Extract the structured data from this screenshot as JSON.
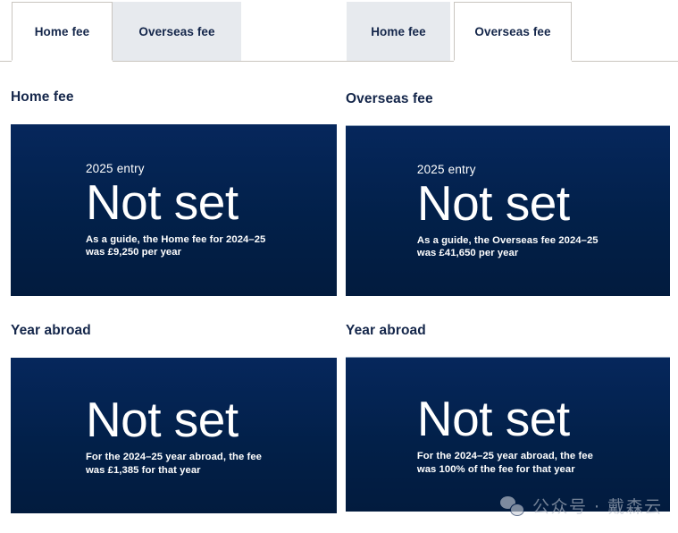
{
  "colors": {
    "card_navy": "#032050",
    "heading_navy": "#14264a",
    "tab_inactive_bg": "#e7eaee",
    "tab_border": "#c9c5bf",
    "card_text": "#ffffff"
  },
  "left_panel": {
    "tabs": [
      {
        "label": "Home fee",
        "active": true
      },
      {
        "label": "Overseas fee",
        "active": false
      }
    ],
    "fee_section": {
      "title": "Home fee",
      "entry_year": "2025 entry",
      "value": "Not set",
      "note": "As a guide, the Home fee for 2024–25\nwas £9,250 per year"
    },
    "year_abroad_section": {
      "title": "Year abroad",
      "value": "Not set",
      "note": "For the 2024–25 year abroad, the fee\nwas £1,385 for that year"
    }
  },
  "right_panel": {
    "tabs": [
      {
        "label": "Home fee",
        "active": false
      },
      {
        "label": "Overseas fee",
        "active": true
      }
    ],
    "fee_section": {
      "title": "Overseas fee",
      "entry_year": "2025 entry",
      "value": "Not set",
      "note": "As a guide, the Overseas fee 2024–25\nwas £41,650 per year"
    },
    "year_abroad_section": {
      "title": "Year abroad",
      "value": "Not set",
      "note": "For the 2024–25 year abroad, the fee\nwas 100% of the fee for that year"
    }
  },
  "watermark": {
    "icon": "wechat-icon",
    "text": "公众号 · 戴森云"
  }
}
